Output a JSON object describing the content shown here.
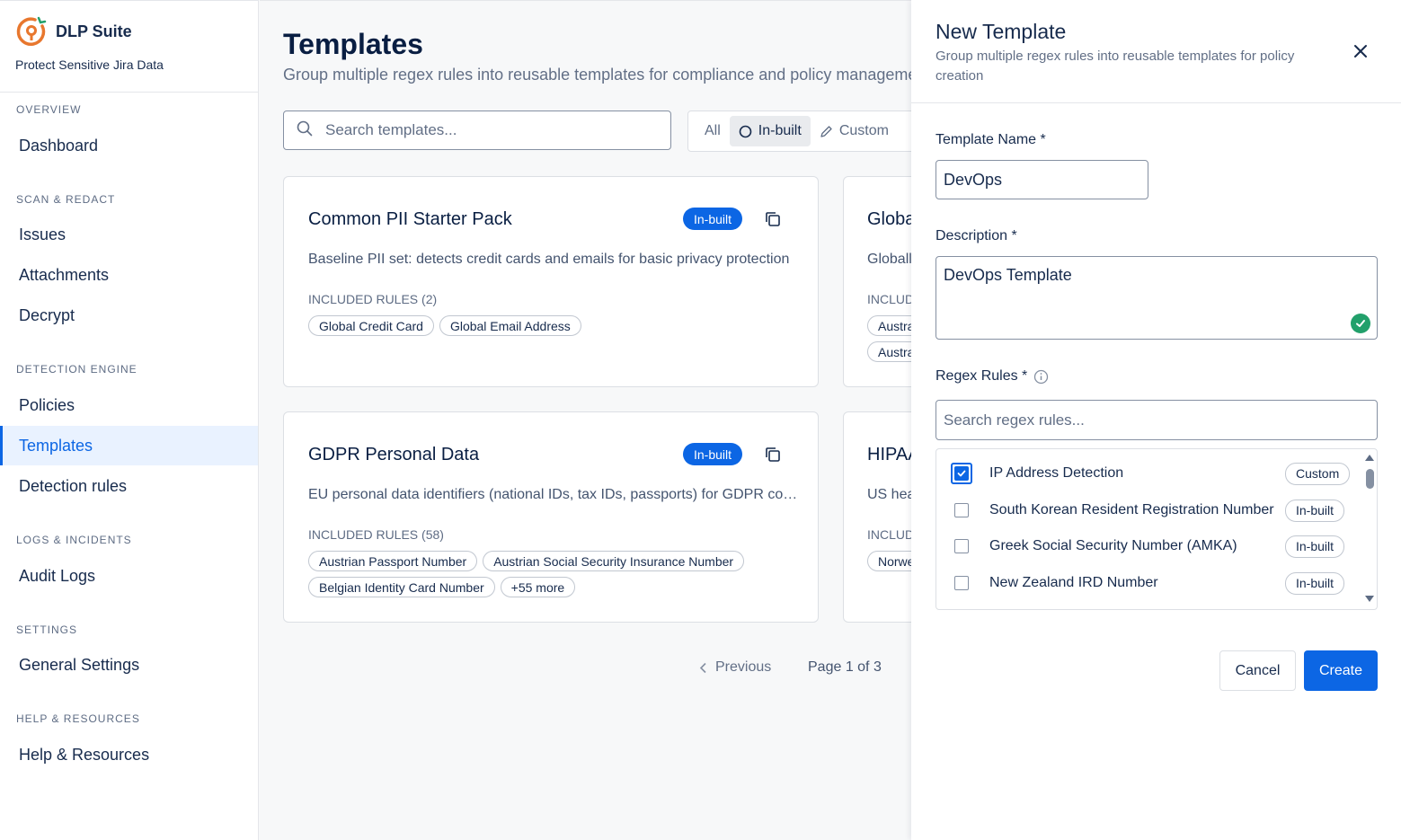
{
  "brand": {
    "name": "DLP Suite",
    "subtitle": "Protect Sensitive Jira Data"
  },
  "sidebar": {
    "sections": [
      {
        "title": "OVERVIEW",
        "items": [
          "Dashboard"
        ]
      },
      {
        "title": "SCAN & REDACT",
        "items": [
          "Issues",
          "Attachments",
          "Decrypt"
        ]
      },
      {
        "title": "DETECTION ENGINE",
        "items": [
          "Policies",
          "Templates",
          "Detection rules"
        ]
      },
      {
        "title": "LOGS & INCIDENTS",
        "items": [
          "Audit Logs"
        ]
      },
      {
        "title": "SETTINGS",
        "items": [
          "General Settings"
        ]
      },
      {
        "title": "HELP & RESOURCES",
        "items": [
          "Help & Resources"
        ]
      }
    ],
    "active": "Templates"
  },
  "main": {
    "title": "Templates",
    "subtitle": "Group multiple regex rules into reusable templates for compliance and policy management",
    "search_placeholder": "Search templates...",
    "filters": {
      "all": "All",
      "inbuilt": "In-built",
      "custom": "Custom",
      "selected": "In-built"
    },
    "cards": [
      {
        "title": "Common PII Starter Pack",
        "badge": "In-built",
        "description": "Baseline PII set: detects credit cards and emails for basic privacy protection",
        "included": "INCLUDED RULES (2)",
        "rules": [
          "Global Credit Card",
          "Global Email Address"
        ]
      },
      {
        "title": "GDPR Personal Data",
        "badge": "In-built",
        "description": "EU personal data identifiers (national IDs, tax IDs, passports) for GDPR compliance",
        "included": "INCLUDED RULES (58)",
        "rules": [
          "Austrian Passport Number",
          "Austrian Social Security Insurance Number",
          "Belgian Identity Card Number",
          "+55 more"
        ]
      }
    ],
    "partial_cards": [
      {
        "title": "Globa",
        "description": "Globall",
        "included": "INCLUD",
        "rules": [
          "Austra",
          "Austra"
        ]
      },
      {
        "title": "HIPAA",
        "description": "US hea",
        "included": "INCLUD",
        "rules": [
          "Norwe"
        ]
      }
    ],
    "pager": {
      "previous": "Previous",
      "page": "Page 1 of 3"
    }
  },
  "drawer": {
    "title": "New Template",
    "subtitle": "Group multiple regex rules into reusable templates for policy creation",
    "name_label": "Template Name *",
    "name_value": "DevOps",
    "desc_label": "Description *",
    "desc_value": "DevOps Template",
    "rules_label": "Regex Rules *",
    "rules_search_placeholder": "Search regex rules...",
    "rules": [
      {
        "name": "IP Address Detection",
        "tag": "Custom",
        "checked": true
      },
      {
        "name": "South Korean Resident Registration Number",
        "tag": "In-built",
        "checked": false
      },
      {
        "name": "Greek Social Security Number (AMKA)",
        "tag": "In-built",
        "checked": false
      },
      {
        "name": "New Zealand IRD Number",
        "tag": "In-built",
        "checked": false
      }
    ],
    "cancel": "Cancel",
    "create": "Create"
  },
  "colors": {
    "accent": "#0c66e4",
    "success": "#22a06b",
    "logo": "#e8772e"
  }
}
